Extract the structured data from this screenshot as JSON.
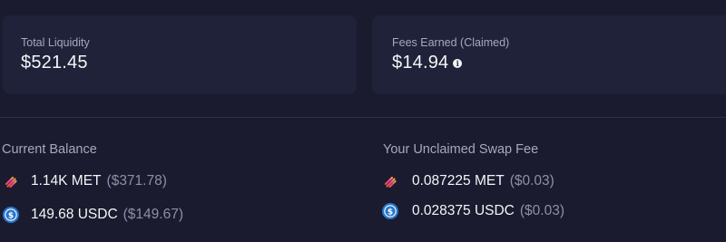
{
  "total_liquidity": {
    "label": "Total Liquidity",
    "value": "$521.45"
  },
  "fees_earned": {
    "label": "Fees Earned (Claimed)",
    "value": "$14.94",
    "info_icon": "info-icon"
  },
  "current_balance": {
    "heading": "Current Balance",
    "tokens": [
      {
        "icon": "met-token-icon",
        "amount": "1.14K MET",
        "usd": "($371.78)"
      },
      {
        "icon": "usdc-token-icon",
        "amount": "149.68 USDC",
        "usd": "($149.67)"
      }
    ]
  },
  "unclaimed_swap_fee": {
    "heading": "Your Unclaimed Swap Fee",
    "tokens": [
      {
        "icon": "met-token-icon",
        "amount": "0.087225 MET",
        "usd": "($0.03)"
      },
      {
        "icon": "usdc-token-icon",
        "amount": "0.028375 USDC",
        "usd": "($0.03)"
      }
    ]
  },
  "colors": {
    "background": "#1a1b2e",
    "card": "#1f2238",
    "muted_text": "#a6a8bf",
    "usdc_blue": "#2775ca"
  }
}
